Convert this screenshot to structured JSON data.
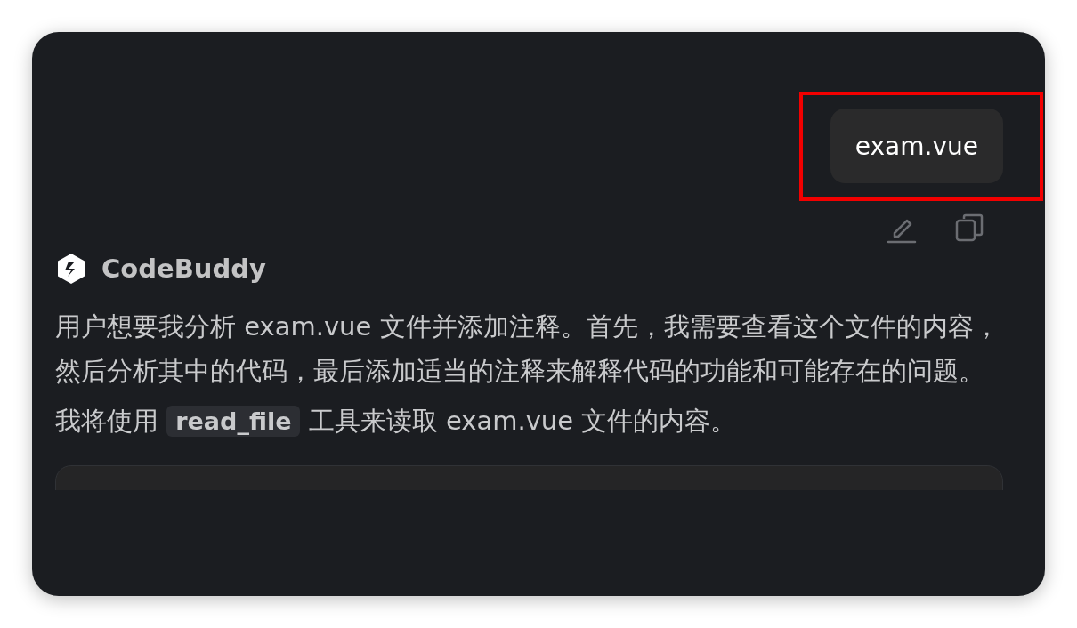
{
  "user_message": {
    "text": "exam.vue",
    "highlighted": true
  },
  "assistant": {
    "name": "CodeBuddy",
    "paragraphs": [
      [
        {
          "kind": "text",
          "text": "用户想要我分析 exam.vue 文件并添加注释。首先，我需要查看这个文件的内容，然后分析其中的代码，最后添加适当的注释来解释代码的功能和可能存在的问题。"
        }
      ],
      [
        {
          "kind": "text",
          "text": "我将使用 "
        },
        {
          "kind": "code",
          "text": "read_file"
        },
        {
          "kind": "text",
          "text": " 工具来读取 exam.vue 文件的内容。"
        }
      ]
    ]
  }
}
